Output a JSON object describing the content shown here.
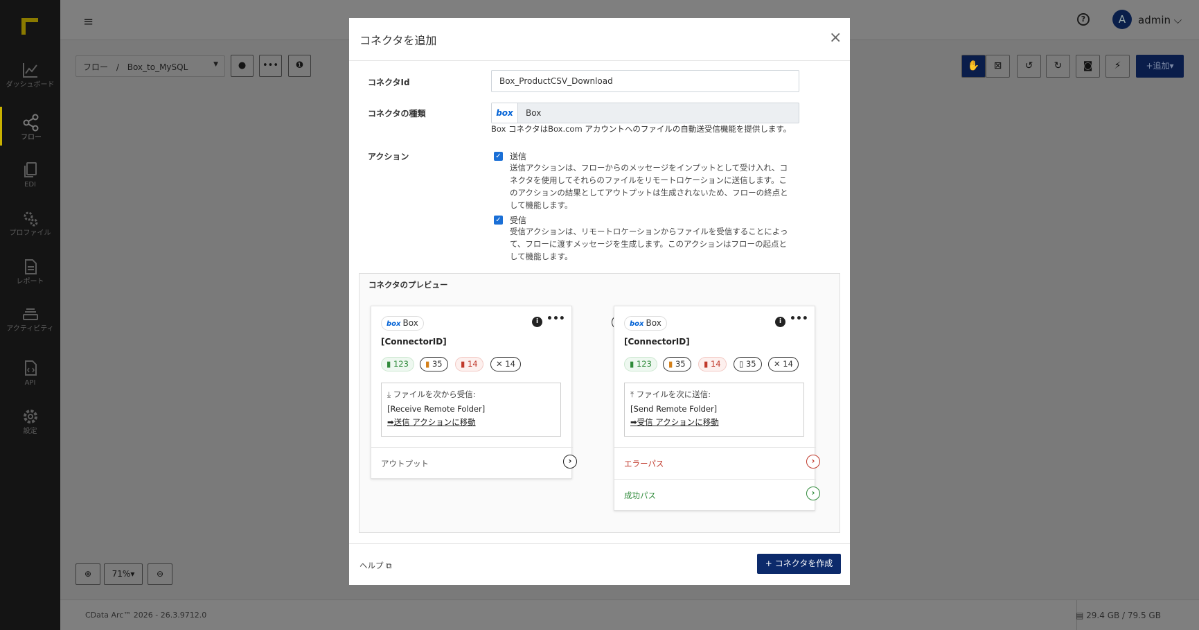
{
  "nav": [
    {
      "label": "ダッシュボード",
      "icon": "chart-line-icon"
    },
    {
      "label": "フロー",
      "icon": "share-nodes-icon"
    },
    {
      "label": "EDI",
      "icon": "documents-icon"
    },
    {
      "label": "プロファイル",
      "icon": "gears-icon"
    },
    {
      "label": "レポート",
      "icon": "report-icon"
    },
    {
      "label": "アクティビティ",
      "icon": "stack-icon"
    },
    {
      "label": "API",
      "icon": "api-file-icon"
    },
    {
      "label": "設定",
      "icon": "gear-icon"
    }
  ],
  "topbar": {
    "hamburger": "≡",
    "help": "?",
    "avatar_initial": "A",
    "user": "admin",
    "caret": "⌵"
  },
  "breadcrumb": {
    "root": "フロー",
    "sep": "/",
    "name": "Box_to_MySQL"
  },
  "toolbar": {
    "add_label": "追加"
  },
  "zoom": {
    "level": "71%"
  },
  "footer": {
    "version": "CData Arc™ 2026 - 26.3.9712.0",
    "storage": "29.4 GB / 79.5 GB"
  },
  "modal": {
    "title": "コネクタを追加",
    "close": "×",
    "fields": {
      "id_label": "コネクタId",
      "id_value": "Box_ProductCSV_Download",
      "type_label": "コネクタの種類",
      "type_logo": "box",
      "type_value": "Box",
      "type_desc": "Box コネクタはBox.com アカウントへのファイルの自動送受信機能を提供します。",
      "action_label": "アクション",
      "send_label": "送信",
      "send_desc": "送信アクションは、フローからのメッセージをインプットとして受け入れ、コネクタを使用してそれらのファイルをリモートロケーションに送信します。このアクションの結果としてアウトプットは生成されないため、フローの終点として機能します。",
      "recv_label": "受信",
      "recv_desc": "受信アクションは、リモートロケーションからファイルを受信することによって、フローに渡すメッセージを生成します。このアクションはフローの起点として機能します。"
    },
    "preview": {
      "title": "コネクタのプレビュー",
      "card1": {
        "chip_logo": "box",
        "chip_name": "Box",
        "id": "[ConnectorID]",
        "badges": [
          "123",
          "35",
          "14",
          "14"
        ],
        "l1": "ファイルを次から受信:",
        "l2": "[Receive Remote Folder]",
        "l3": "送信 アクションに移動",
        "footer": "アウトプット"
      },
      "card2": {
        "chip_logo": "box",
        "chip_name": "Box",
        "id": "[ConnectorID]",
        "badges": [
          "123",
          "35",
          "14",
          "35",
          "14"
        ],
        "l1": "ファイルを次に送信:",
        "l2": "[Send Remote Folder]",
        "l3": "受信 アクションに移動",
        "footer_error": "エラーパス",
        "footer_success": "成功パス"
      }
    },
    "help": "ヘルプ",
    "create": "コネクタを作成"
  },
  "colors": {
    "accent": "#0c2a6b",
    "green": "#2f8a3a",
    "red": "#c0392b",
    "logo_yellow": "#c9b100"
  }
}
